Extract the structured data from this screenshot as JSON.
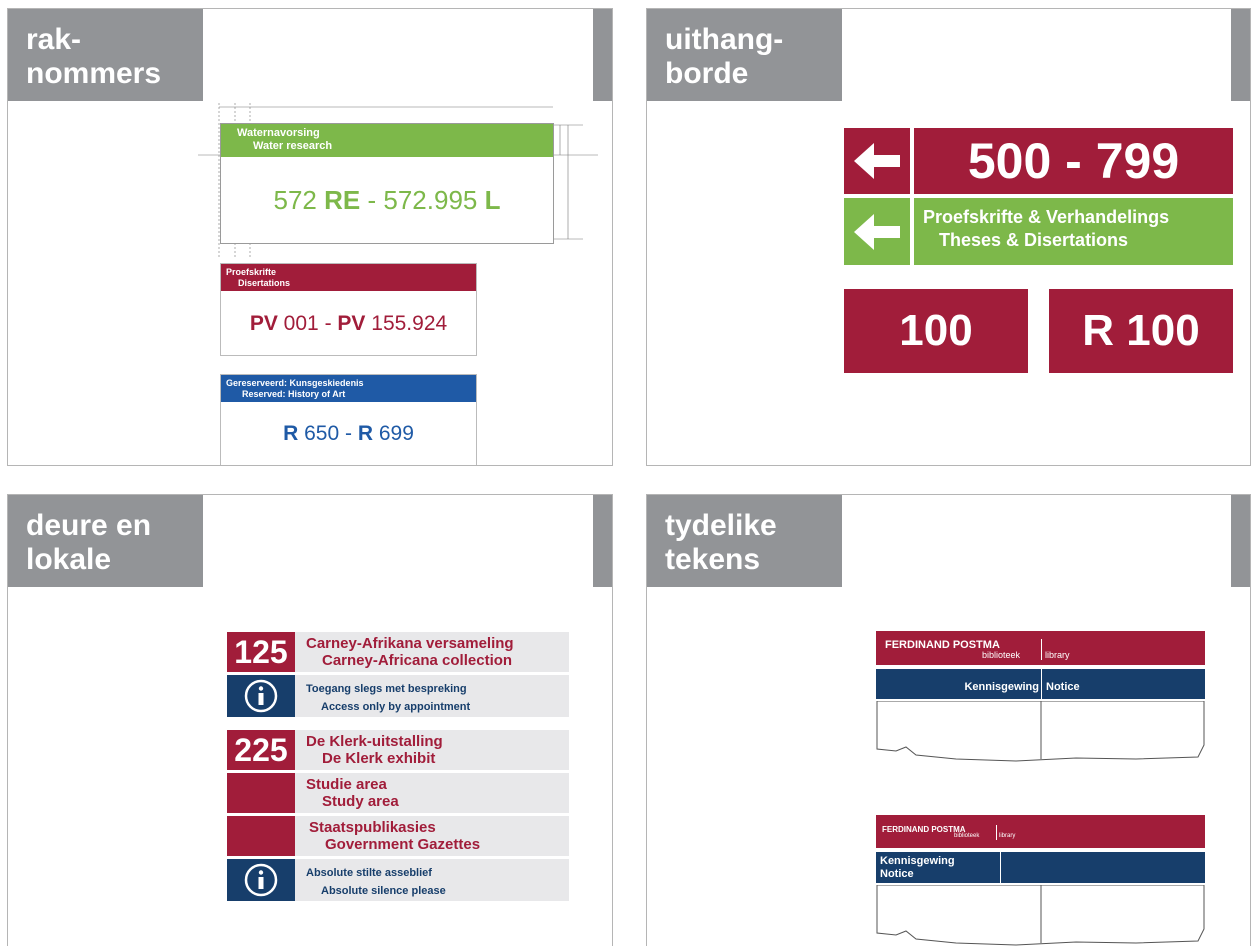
{
  "panels": {
    "rak": {
      "tab_line1": "rak-",
      "tab_line2": "nommers",
      "green_sign": {
        "line1": "Waternavorsing",
        "line2": "Water research",
        "range_a": "572",
        "range_a_suffix": "RE",
        "dash": "-",
        "range_b": "572.995",
        "range_b_suffix": "L"
      },
      "red_sign": {
        "line1": "Proefskrifte",
        "line2": "Disertations",
        "prefix_a": "PV",
        "num_a": "001",
        "dash": "-",
        "prefix_b": "PV",
        "num_b": "155.924"
      },
      "blue_sign": {
        "line1": "Gereserveerd: Kunsgeskiedenis",
        "line2": "Reserved: History of Art",
        "prefix_a": "R",
        "num_a": "650",
        "dash": "-",
        "prefix_b": "R",
        "num_b": "699"
      }
    },
    "uithang": {
      "tab_line1": "uithang-",
      "tab_line2": "borde",
      "range": "500 - 799",
      "subject_line1": "Proefskrifte & Verhandelings",
      "subject_line2": "Theses & Disertations",
      "box1": "100",
      "box2": "R 100"
    },
    "deure": {
      "tab_line1": "deure en",
      "tab_line2": "lokale",
      "rows": [
        {
          "number": "125",
          "line1": "Carney-Afrikana versameling",
          "line2": "Carney-Africana collection"
        },
        {
          "icon": "info-icon",
          "line1": "Toegang slegs met bespreking",
          "line2": "Access only by appointment"
        },
        {
          "number": "225",
          "line1": "De Klerk-uitstalling",
          "line2": "De Klerk exhibit"
        },
        {
          "line1": "Studie area",
          "line2": "Study area"
        },
        {
          "line1": "Staatspublikasies",
          "line2": "Government Gazettes"
        },
        {
          "icon": "info-icon",
          "line1": "Absolute stilte asseblief",
          "line2": "Absolute silence please"
        }
      ]
    },
    "tydelike": {
      "tab_line1": "tydelike",
      "tab_line2": "tekens",
      "notice1": {
        "brand": "FERDINAND POSTMA",
        "bib": "biblioteek",
        "lib": "library",
        "left": "Kennisgewing",
        "right": "Notice"
      },
      "notice2": {
        "brand": "FERDINAND POSTMA",
        "bib": "biblioteek",
        "lib": "library",
        "line1": "Kennisgewing",
        "line2": "Notice"
      }
    }
  },
  "colors": {
    "red": "#a11d3a",
    "green": "#7db84a",
    "blue": "#214f8f",
    "gray_tab": "#929497"
  }
}
